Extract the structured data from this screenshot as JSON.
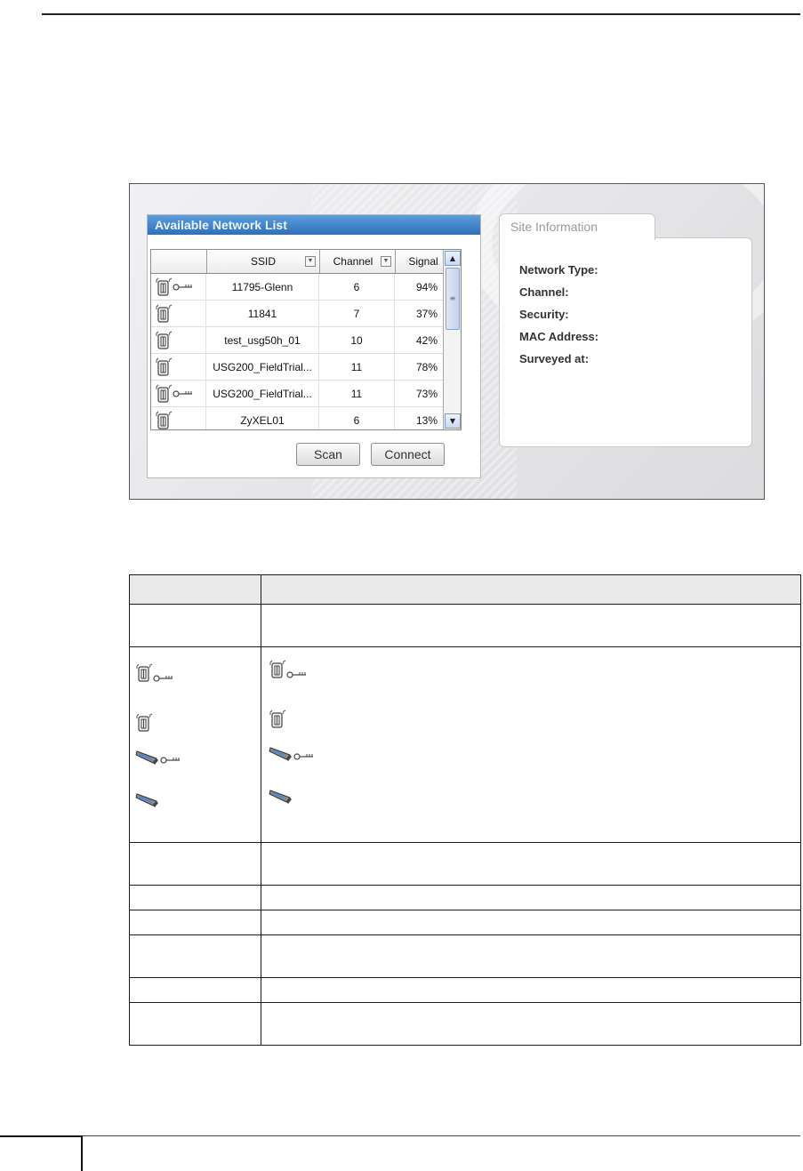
{
  "network_list": {
    "title": "Available Network List",
    "columns": [
      "",
      "SSID",
      "Channel",
      "Signal"
    ],
    "rows": [
      {
        "icon": "access-point-secured",
        "ssid": "11795-Glenn",
        "channel": "6",
        "signal": "94%"
      },
      {
        "icon": "access-point",
        "ssid": "11841",
        "channel": "7",
        "signal": "37%"
      },
      {
        "icon": "access-point",
        "ssid": "test_usg50h_01",
        "channel": "10",
        "signal": "42%"
      },
      {
        "icon": "access-point",
        "ssid": "USG200_FieldTrial...",
        "channel": "11",
        "signal": "78%"
      },
      {
        "icon": "access-point-secured",
        "ssid": "USG200_FieldTrial...",
        "channel": "11",
        "signal": "73%"
      },
      {
        "icon": "access-point",
        "ssid": "ZyXEL01",
        "channel": "6",
        "signal": "13%"
      }
    ],
    "scan_label": "Scan",
    "connect_label": "Connect"
  },
  "site_information": {
    "tab_label": "Site Information",
    "fields": [
      "Network Type:",
      "Channel:",
      "Security:",
      "MAC Address:",
      "Surveyed at:"
    ]
  },
  "icon_table": {
    "icons": [
      "access-point-secured",
      "access-point",
      "ad-hoc-secured",
      "ad-hoc"
    ]
  },
  "colors": {
    "title_bar": "#2f6fb9",
    "header_fill": "#e9e9e9"
  }
}
